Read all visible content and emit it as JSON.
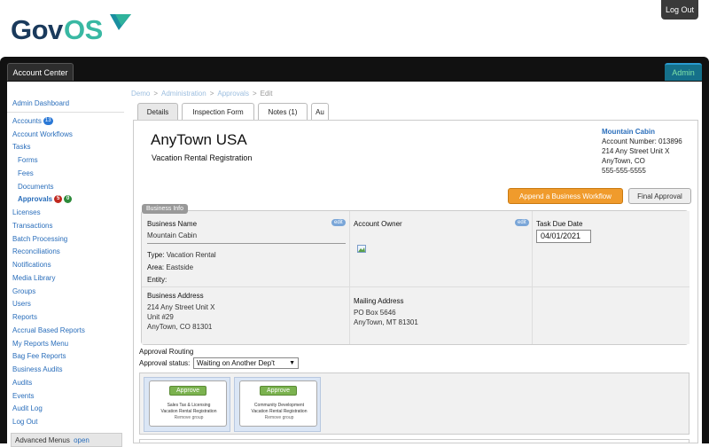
{
  "header": {
    "logo_text": "GovOS",
    "logout_label": "Log Out"
  },
  "shell": {
    "account_center_tab": "Account Center",
    "admin_tab": "Admin"
  },
  "sidebar": {
    "items": [
      {
        "label": "Admin Dashboard"
      },
      {
        "label": "Accounts",
        "badge": "13"
      },
      {
        "label": "Account Workflows"
      },
      {
        "label": "Tasks"
      },
      {
        "label": "Forms"
      },
      {
        "label": "Fees"
      },
      {
        "label": "Documents"
      },
      {
        "label": "Approvals",
        "badge_red": "5",
        "badge_green": "0"
      },
      {
        "label": "Licenses"
      },
      {
        "label": "Transactions"
      },
      {
        "label": "Batch Processing"
      },
      {
        "label": "Reconciliations"
      },
      {
        "label": "Notifications"
      },
      {
        "label": "Media Library"
      },
      {
        "label": "Groups"
      },
      {
        "label": "Users"
      },
      {
        "label": "Reports"
      },
      {
        "label": "Accrual Based Reports"
      },
      {
        "label": "My Reports Menu"
      },
      {
        "label": "Bag Fee Reports"
      },
      {
        "label": "Business Audits"
      },
      {
        "label": "Audits"
      },
      {
        "label": "Events"
      },
      {
        "label": "Audit Log"
      },
      {
        "label": "Log Out"
      }
    ],
    "advanced_menus_label": "Advanced Menus",
    "advanced_menus_link": "open"
  },
  "breadcrumb": {
    "items": [
      "Demo",
      "Administration",
      "Approvals"
    ],
    "current": "Edit",
    "separator": ">"
  },
  "tabs": [
    "Details",
    "Inspection Form",
    "Notes (1)",
    "Au"
  ],
  "record": {
    "town": "AnyTown USA",
    "subtitle": "Vacation Rental Registration",
    "account_name": "Mountain Cabin",
    "account_number": "Account Number: 013896",
    "address1": "214 Any Street Unit X",
    "address2": "AnyTown, CO",
    "phone": "555-555-5555"
  },
  "actions": {
    "append_label": "Append a Business Workflow",
    "final_label": "Final Approval"
  },
  "business_info": {
    "section_label": "Business Info",
    "edit_label": "edit",
    "business_name_title": "Business Name",
    "business_name": "Mountain Cabin",
    "type_label": "Type:",
    "type_value": "Vacation Rental",
    "area_label": "Area:",
    "area_value": "Eastside",
    "entity_label": "Entity:",
    "entity_value": "",
    "owner_title": "Account Owner",
    "due_title": "Task Due Date",
    "due_value": "04/01/2021",
    "business_address_title": "Business Address",
    "business_address_lines": [
      "214 Any Street Unit X",
      "Unit #29",
      "AnyTown, CO 81301"
    ],
    "mailing_address_title": "Mailing Address",
    "mailing_address_lines": [
      "PO Box 5646",
      "AnyTown, MT 81301"
    ]
  },
  "routing": {
    "title": "Approval Routing",
    "status_label": "Approval status:",
    "status_value": "Waiting on Another Dep't",
    "groups": [
      {
        "approve_label": "Approve",
        "dept": "Sales Tax & Licensing",
        "task": "Vacation Rental Registration",
        "remove_label": "Remove group"
      },
      {
        "approve_label": "Approve",
        "dept": "Community Development",
        "task": "Vacation Rental Registration",
        "remove_label": "Remove group"
      }
    ]
  },
  "colors": {
    "brand_dark": "#1a3a5c",
    "brand_teal": "#39b8a3",
    "accent_orange": "#f09b2c",
    "link_blue": "#2a6ebb"
  }
}
